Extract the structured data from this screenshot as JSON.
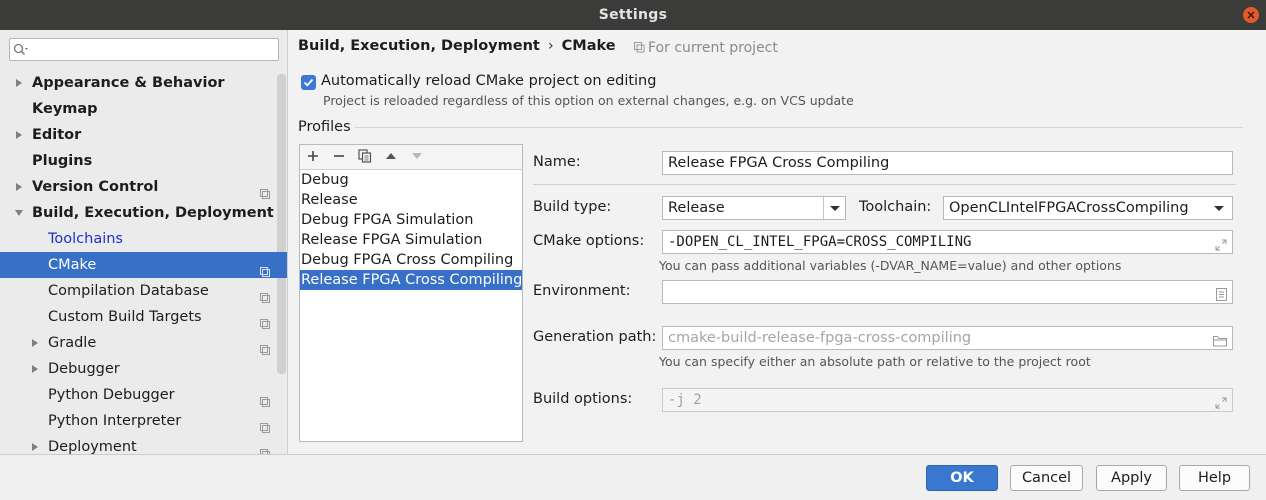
{
  "window": {
    "title": "Settings"
  },
  "sidebar": {
    "search_placeholder": "",
    "items": [
      {
        "label": "Appearance & Behavior"
      },
      {
        "label": "Keymap"
      },
      {
        "label": "Editor"
      },
      {
        "label": "Plugins"
      },
      {
        "label": "Version Control"
      },
      {
        "label": "Build, Execution, Deployment"
      },
      {
        "label": "Toolchains"
      },
      {
        "label": "CMake"
      },
      {
        "label": "Compilation Database"
      },
      {
        "label": "Custom Build Targets"
      },
      {
        "label": "Gradle"
      },
      {
        "label": "Debugger"
      },
      {
        "label": "Python Debugger"
      },
      {
        "label": "Python Interpreter"
      },
      {
        "label": "Deployment"
      }
    ]
  },
  "header": {
    "breadcrumb_parent": "Build, Execution, Deployment",
    "breadcrumb_sep": "›",
    "breadcrumb_current": "CMake",
    "scope": "For current project"
  },
  "auto_reload": {
    "checked": true,
    "label": "Automatically reload CMake project on editing",
    "hint": "Project is reloaded regardless of this option on external changes, e.g. on VCS update"
  },
  "profiles": {
    "title": "Profiles",
    "toolbar": [
      "+",
      "−",
      "copy",
      "up",
      "down"
    ],
    "items": [
      "Debug",
      "Release",
      "Debug FPGA Simulation",
      "Release FPGA Simulation",
      "Debug FPGA Cross Compiling",
      "Release FPGA Cross Compiling"
    ],
    "selected": "Release FPGA Cross Compiling"
  },
  "form": {
    "name_label": "Name:",
    "name_value": "Release FPGA Cross Compiling",
    "build_type_label": "Build type:",
    "build_type_value": "Release",
    "toolchain_label": "Toolchain:",
    "toolchain_value": "OpenCLIntelFPGACrossCompiling",
    "cmake_options_label": "CMake options:",
    "cmake_options_value": "-DOPEN_CL_INTEL_FPGA=CROSS_COMPILING",
    "cmake_options_hint": "You can pass additional variables (-DVAR_NAME=value) and other options",
    "environment_label": "Environment:",
    "environment_value": "",
    "generation_path_label": "Generation path:",
    "generation_path_placeholder": "cmake-build-release-fpga-cross-compiling",
    "generation_path_hint": "You can specify either an absolute path or relative to the project root",
    "build_options_label": "Build options:",
    "build_options_placeholder": "-j 2"
  },
  "footer": {
    "ok": "OK",
    "cancel": "Cancel",
    "apply": "Apply",
    "help": "Help"
  },
  "colors": {
    "accent": "#3870c8",
    "link": "#2030c8",
    "titlebar": "#3b3b39",
    "close": "#e25a2c"
  }
}
